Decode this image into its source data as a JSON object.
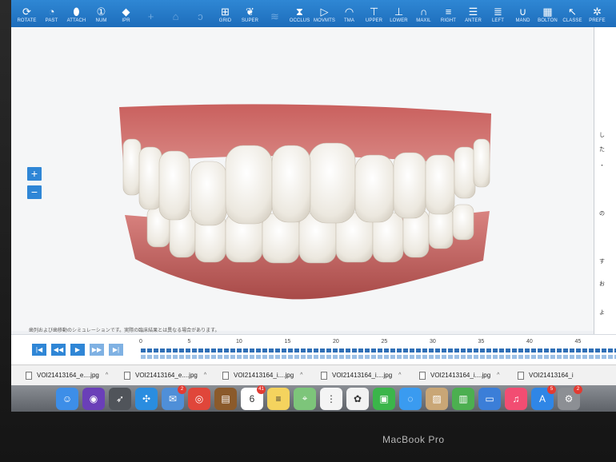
{
  "toolbar": {
    "items": [
      {
        "label": "ROTATE",
        "icon": "rotate-icon",
        "glyph": "⟳",
        "dim": false
      },
      {
        "label": "PAST",
        "icon": "history-icon",
        "glyph": "◔",
        "dim": false
      },
      {
        "label": "ATTACH",
        "icon": "attach-icon",
        "glyph": "⬮",
        "dim": false
      },
      {
        "label": "NUM",
        "icon": "number-icon",
        "glyph": "①",
        "dim": false
      },
      {
        "label": "IPR",
        "icon": "diamond-icon",
        "glyph": "◆",
        "dim": false
      },
      {
        "label": "",
        "icon": "plus-icon",
        "glyph": "+",
        "dim": true
      },
      {
        "label": "",
        "icon": "lock-icon",
        "glyph": "⌂",
        "dim": true
      },
      {
        "label": "",
        "icon": "ear-icon",
        "glyph": "ↄ",
        "dim": true
      },
      {
        "label": "GRID",
        "icon": "grid-icon",
        "glyph": "⊞",
        "dim": false
      },
      {
        "label": "SUPER",
        "icon": "tooth-icon",
        "glyph": "❦",
        "dim": false
      },
      {
        "label": "",
        "icon": "wave-icon",
        "glyph": "≋",
        "dim": true
      },
      {
        "label": "OCCLUS",
        "icon": "occlusion-icon",
        "glyph": "⧗",
        "dim": false
      },
      {
        "label": "MOVMTS",
        "icon": "play-circle-icon",
        "glyph": "▷",
        "dim": false
      },
      {
        "label": "TMA",
        "icon": "gauge-icon",
        "glyph": "◠",
        "dim": false
      },
      {
        "label": "UPPER",
        "icon": "upper-jaw-icon",
        "glyph": "⊤",
        "dim": false
      },
      {
        "label": "LOWER",
        "icon": "lower-jaw-icon",
        "glyph": "⊥",
        "dim": false
      },
      {
        "label": "MAXIL",
        "icon": "arch-icon",
        "glyph": "∩",
        "dim": false
      },
      {
        "label": "RIGHT",
        "icon": "right-view-icon",
        "glyph": "≡",
        "dim": false
      },
      {
        "label": "ANTER",
        "icon": "anterior-view-icon",
        "glyph": "☰",
        "dim": false
      },
      {
        "label": "LEFT",
        "icon": "left-view-icon",
        "glyph": "≣",
        "dim": false
      },
      {
        "label": "MAND",
        "icon": "mandible-icon",
        "glyph": "∪",
        "dim": false
      },
      {
        "label": "BOLTON",
        "icon": "calculator-icon",
        "glyph": "▦",
        "dim": false
      },
      {
        "label": "CLASSE",
        "icon": "cursor-icon",
        "glyph": "↖",
        "dim": false
      },
      {
        "label": "PREFE",
        "icon": "gear-icon",
        "glyph": "✲",
        "dim": false
      }
    ]
  },
  "zoom": {
    "plus": "+",
    "minus": "−"
  },
  "side_panel": {
    "texts": [
      "し",
      "た",
      "・",
      "の",
      "す",
      "お",
      "よ"
    ]
  },
  "note": "歯列および歯移動のシミュレーションです。実際の臨床結果とは異なる場合があります。",
  "playback": [
    {
      "name": "first-stage-button",
      "glyph": "|◀",
      "dim": false
    },
    {
      "name": "previous-stage-button",
      "glyph": "◀◀",
      "dim": false
    },
    {
      "name": "play-button",
      "glyph": "▶",
      "dim": false
    },
    {
      "name": "next-stage-button",
      "glyph": "▶▶",
      "dim": true
    },
    {
      "name": "last-stage-button",
      "glyph": "▶|",
      "dim": true
    }
  ],
  "timeline": {
    "ticks": [
      "0",
      "5",
      "10",
      "15",
      "20",
      "25",
      "30",
      "35",
      "40",
      "45"
    ]
  },
  "downloads": [
    {
      "file": "VOI21413164_e....jpg"
    },
    {
      "file": "VOI21413164_e....jpg"
    },
    {
      "file": "VOI21413164_i....jpg"
    },
    {
      "file": "VOI21413164_i....jpg"
    },
    {
      "file": "VOI21413164_i....jpg"
    },
    {
      "file": "VOI21413164_i"
    }
  ],
  "dock": [
    {
      "name": "finder-icon",
      "color": "#3d8ee8",
      "glyph": "☺",
      "badge": ""
    },
    {
      "name": "siri-icon",
      "color": "#6a3fb8",
      "glyph": "◉",
      "badge": ""
    },
    {
      "name": "launchpad-icon",
      "color": "#50545a",
      "glyph": "➶",
      "badge": ""
    },
    {
      "name": "safari-icon",
      "color": "#2a8de0",
      "glyph": "✣",
      "badge": ""
    },
    {
      "name": "mail-icon",
      "color": "#4f8fd8",
      "glyph": "✉",
      "badge": "2"
    },
    {
      "name": "chrome-icon",
      "color": "#e0463a",
      "glyph": "◎",
      "badge": ""
    },
    {
      "name": "contacts-icon",
      "color": "#8b5a2b",
      "glyph": "▤",
      "badge": ""
    },
    {
      "name": "calendar-icon",
      "color": "#ffffff",
      "glyph": "6",
      "badge": "41"
    },
    {
      "name": "notes-icon",
      "color": "#f4d35e",
      "glyph": "≡",
      "badge": ""
    },
    {
      "name": "maps-icon",
      "color": "#7dc57a",
      "glyph": "⌖",
      "badge": ""
    },
    {
      "name": "reminders-icon",
      "color": "#f4f4f4",
      "glyph": "⋮",
      "badge": ""
    },
    {
      "name": "photos-icon",
      "color": "#f2f2f2",
      "glyph": "✿",
      "badge": ""
    },
    {
      "name": "facetime-icon",
      "color": "#3bb54a",
      "glyph": "▣",
      "badge": ""
    },
    {
      "name": "messages-icon",
      "color": "#3a9bf0",
      "glyph": "◌",
      "badge": ""
    },
    {
      "name": "keynote-photos-icon",
      "color": "#c9a676",
      "glyph": "▨",
      "badge": ""
    },
    {
      "name": "numbers-icon",
      "color": "#4caf50",
      "glyph": "▥",
      "badge": ""
    },
    {
      "name": "keynote-icon",
      "color": "#3b7ed8",
      "glyph": "▭",
      "badge": ""
    },
    {
      "name": "itunes-icon",
      "color": "#f24d72",
      "glyph": "♫",
      "badge": ""
    },
    {
      "name": "app-store-icon",
      "color": "#2f86e6",
      "glyph": "A",
      "badge": "5"
    },
    {
      "name": "system-preferences-icon",
      "color": "#8c8f94",
      "glyph": "⚙",
      "badge": "2"
    }
  ],
  "brand": "MacBook Pro"
}
